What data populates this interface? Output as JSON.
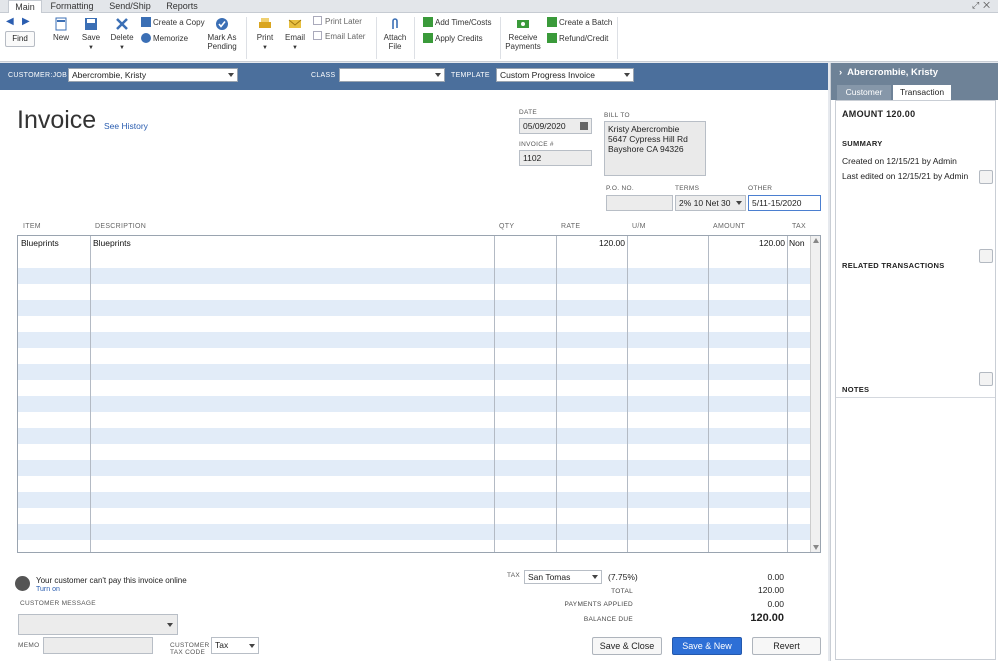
{
  "tabs": [
    "Main",
    "Formatting",
    "Send/Ship",
    "Reports"
  ],
  "ribbon": {
    "find": "Find",
    "new": "New",
    "save": "Save",
    "delete": "Delete",
    "create_copy": "Create a Copy",
    "memorize": "Memorize",
    "mark_pending_1": "Mark As",
    "mark_pending_2": "Pending",
    "print": "Print",
    "email": "Email",
    "print_later": "Print Later",
    "email_later": "Email Later",
    "attach_1": "Attach",
    "attach_2": "File",
    "add_time": "Add Time/Costs",
    "apply_credits": "Apply Credits",
    "receive_1": "Receive",
    "receive_2": "Payments",
    "create_batch": "Create a Batch",
    "refund": "Refund/Credit"
  },
  "bar": {
    "customer_job_label": "CUSTOMER:JOB",
    "customer_job": "Abercrombie, Kristy",
    "class_label": "CLASS",
    "class_value": "",
    "template_label": "TEMPLATE",
    "template": "Custom Progress Invoice"
  },
  "form": {
    "title": "Invoice",
    "see_history": "See History",
    "date_label": "DATE",
    "date": "05/09/2020",
    "invoice_label": "INVOICE #",
    "invoice_no": "1102",
    "bill_to_label": "BILL TO",
    "bill_to_line1": "Kristy Abercrombie",
    "bill_to_line2": "5647 Cypress Hill Rd",
    "bill_to_line3": "Bayshore CA 94326",
    "po_label": "P.O. NO.",
    "po": "",
    "terms_label": "TERMS",
    "terms": "2% 10 Net 30",
    "other_label": "OTHER",
    "other": "5/11-15/2020"
  },
  "columns": [
    "ITEM",
    "DESCRIPTION",
    "QTY",
    "RATE",
    "U/M",
    "AMOUNT",
    "TAX"
  ],
  "line_items": [
    {
      "item": "Blueprints",
      "description": "Blueprints",
      "qty": "",
      "rate": "120.00",
      "um": "",
      "amount": "120.00",
      "tax": "Non"
    }
  ],
  "footer": {
    "online_msg": "Your customer can't pay this invoice online",
    "turn_on": "Turn on",
    "customer_message_label": "CUSTOMER MESSAGE",
    "memo_label": "MEMO",
    "tax_code_label_1": "CUSTOMER",
    "tax_code_label_2": "TAX CODE",
    "tax_code": "Tax",
    "tax_label": "TAX",
    "tax_item": "San Tomas",
    "tax_rate": "(7.75%)",
    "tax_amount": "0.00",
    "total_label": "TOTAL",
    "total": "120.00",
    "payments_label": "PAYMENTS APPLIED",
    "payments": "0.00",
    "balance_label": "BALANCE DUE",
    "balance": "120.00",
    "save_close": "Save & Close",
    "save_new": "Save & New",
    "revert": "Revert"
  },
  "side": {
    "name": "Abercrombie, Kristy",
    "tab_customer": "Customer",
    "tab_transaction": "Transaction",
    "amount": "AMOUNT 120.00",
    "summary": "SUMMARY",
    "created": "Created on 12/15/21  by  Admin",
    "edited": "Last edited on 12/15/21  by Admin",
    "related": "RELATED TRANSACTIONS",
    "notes": "NOTES"
  }
}
